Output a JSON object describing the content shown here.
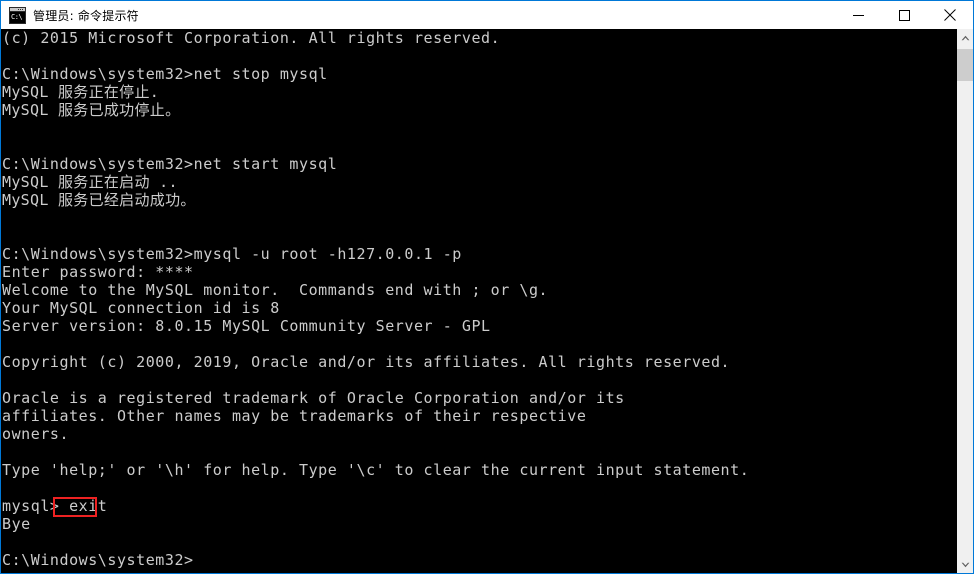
{
  "window": {
    "title": "管理员: 命令提示符",
    "icon_name": "cmd-console-icon",
    "icon_text": "C:\\",
    "border_color": "#0078d7",
    "titlebar_bg": "#ffffff",
    "controls": [
      {
        "name": "minimize-button",
        "glyph": "minimize"
      },
      {
        "name": "maximize-button",
        "glyph": "maximize"
      },
      {
        "name": "close-button",
        "glyph": "close"
      }
    ]
  },
  "console": {
    "background": "#000000",
    "foreground": "#cccccc",
    "lines": [
      "(c) 2015 Microsoft Corporation. All rights reserved.",
      "",
      "C:\\Windows\\system32>net stop mysql",
      "MySQL 服务正在停止.",
      "MySQL 服务已成功停止。",
      "",
      "",
      "C:\\Windows\\system32>net start mysql",
      "MySQL 服务正在启动 ..",
      "MySQL 服务已经启动成功。",
      "",
      "",
      "C:\\Windows\\system32>mysql -u root -h127.0.0.1 -p",
      "Enter password: ****",
      "Welcome to the MySQL monitor.  Commands end with ; or \\g.",
      "Your MySQL connection id is 8",
      "Server version: 8.0.15 MySQL Community Server - GPL",
      "",
      "Copyright (c) 2000, 2019, Oracle and/or its affiliates. All rights reserved.",
      "",
      "Oracle is a registered trademark of Oracle Corporation and/or its",
      "affiliates. Other names may be trademarks of their respective",
      "owners.",
      "",
      "Type 'help;' or '\\h' for help. Type '\\c' to clear the current input statement.",
      "",
      "mysql> exit",
      "Bye",
      "",
      "C:\\Windows\\system32>"
    ],
    "annotation": {
      "name": "exit-command-highlight",
      "target_text": "exit",
      "color": "#ee2222",
      "on_line_index": 26
    }
  },
  "scrollbar": {
    "track_color": "#f0f0f0",
    "thumb_color": "#cdcdcd",
    "up_arrow_name": "scroll-up-arrow",
    "down_arrow_name": "scroll-down-arrow"
  }
}
